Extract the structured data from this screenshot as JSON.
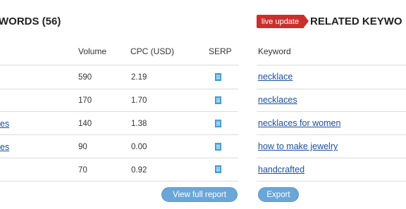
{
  "left_panel": {
    "title": "WORDS (56)",
    "columns": {
      "volume": "Volume",
      "cpc": "CPC (USD)",
      "serp": "SERP"
    },
    "rows": [
      {
        "keyword": "",
        "volume": "590",
        "cpc": "2.19"
      },
      {
        "keyword": "",
        "volume": "170",
        "cpc": "1.70"
      },
      {
        "keyword": "es",
        "volume": "140",
        "cpc": "1.38"
      },
      {
        "keyword": "es",
        "volume": "90",
        "cpc": "0.00"
      },
      {
        "keyword": "",
        "volume": "70",
        "cpc": "0.92"
      }
    ],
    "view_full_report": "View full report"
  },
  "right_panel": {
    "badge": "live update",
    "title": "RELATED KEYWO",
    "column_keyword": "Keyword",
    "rows": [
      "necklace",
      "necklaces",
      "necklaces for women",
      "how to make jewelry",
      "handcrafted"
    ],
    "export": "Export"
  },
  "colors": {
    "accent_button": "#6aa7d8",
    "badge": "#c9302c",
    "link": "#1a4fa0"
  },
  "icons": {
    "serp": "serp-page-icon"
  }
}
